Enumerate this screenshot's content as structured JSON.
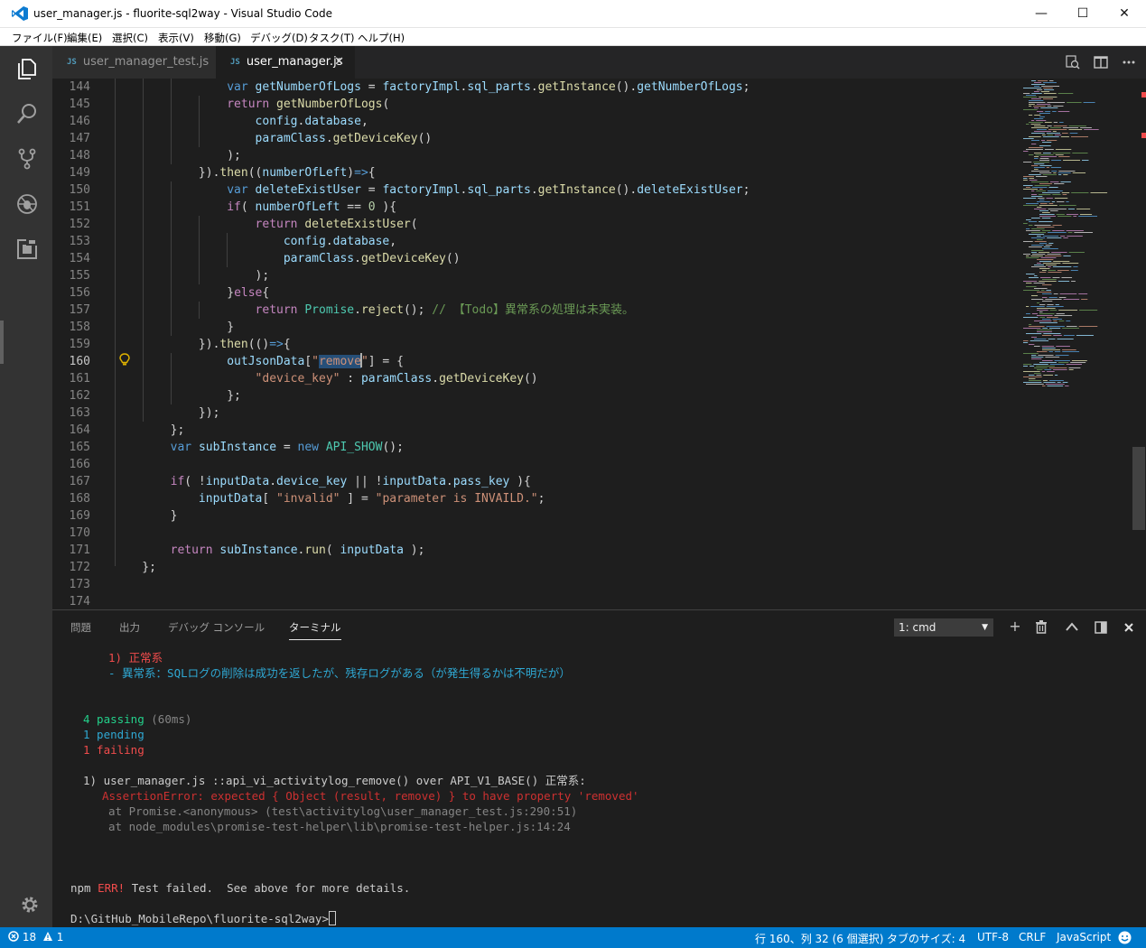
{
  "window": {
    "title": "user_manager.js - fluorite-sql2way - Visual Studio Code",
    "minimize_glyph": "—",
    "maximize_glyph": "☐",
    "close_glyph": "✕"
  },
  "menu": [
    "ファイル(F)",
    "編集(E)",
    "選択(C)",
    "表示(V)",
    "移動(G)",
    "デバッグ(D)",
    "タスク(T)",
    "ヘルプ(H)"
  ],
  "tabs": [
    {
      "badge": "JS",
      "label": "user_manager_test.js",
      "active": false
    },
    {
      "badge": "JS",
      "label": "user_manager.js",
      "active": true,
      "close_glyph": "✕"
    }
  ],
  "editor": {
    "line_numbers": [
      "144",
      "145",
      "146",
      "147",
      "148",
      "149",
      "150",
      "151",
      "152",
      "153",
      "154",
      "155",
      "156",
      "157",
      "158",
      "159",
      "160",
      "161",
      "162",
      "163",
      "164",
      "165",
      "166",
      "167",
      "168",
      "169",
      "170",
      "171",
      "172",
      "173",
      "174"
    ],
    "cursor": {
      "line": 160,
      "column": 32
    }
  },
  "panel": {
    "tabs": [
      "問題",
      "出力",
      "デバッグ コンソール",
      "ターミナル"
    ],
    "active_tab": "ターミナル",
    "terminal_select": "1: cmd",
    "terminal_lines": {
      "l1": "1) 正常系",
      "l2": "- 異常系：SQLログの削除は成功を返したが、残存ログがある（が発生得るかは不明だが）",
      "passing_count": "4 passing",
      "passing_time": "(60ms)",
      "pending": "1 pending",
      "failing": "1 failing",
      "failure_title": "1) user_manager.js ::api_vi_activitylog_remove() over API_V1_BASE() 正常系:",
      "assertion": "AssertionError: expected { Object (result, remove) } to have property 'removed'",
      "stack1": "at Promise.<anonymous> (test\\activitylog\\user_manager_test.js:290:51)",
      "stack2": "at node_modules\\promise-test-helper\\lib\\promise-test-helper.js:14:24",
      "npm_prefix": "npm",
      "npm_err": "ERR!",
      "npm_msg": "Test failed.  See above for more details.",
      "prompt": "D:\\GitHub_MobileRepo\\fluorite-sql2way>"
    }
  },
  "statusbar": {
    "errors": "18",
    "warnings": "1",
    "position": "行 160、列 32 (6 個選択)",
    "tab_size": "タブのサイズ: 4",
    "encoding": "UTF-8",
    "eol": "CRLF",
    "language": "JavaScript"
  },
  "colors": {
    "statusbar": "#007acc",
    "activitybar": "#333333",
    "editor_bg": "#1e1e1e",
    "error_red": "#f14c4c",
    "pass_green": "#23d18b",
    "pending_cyan": "#2fa8d3"
  }
}
